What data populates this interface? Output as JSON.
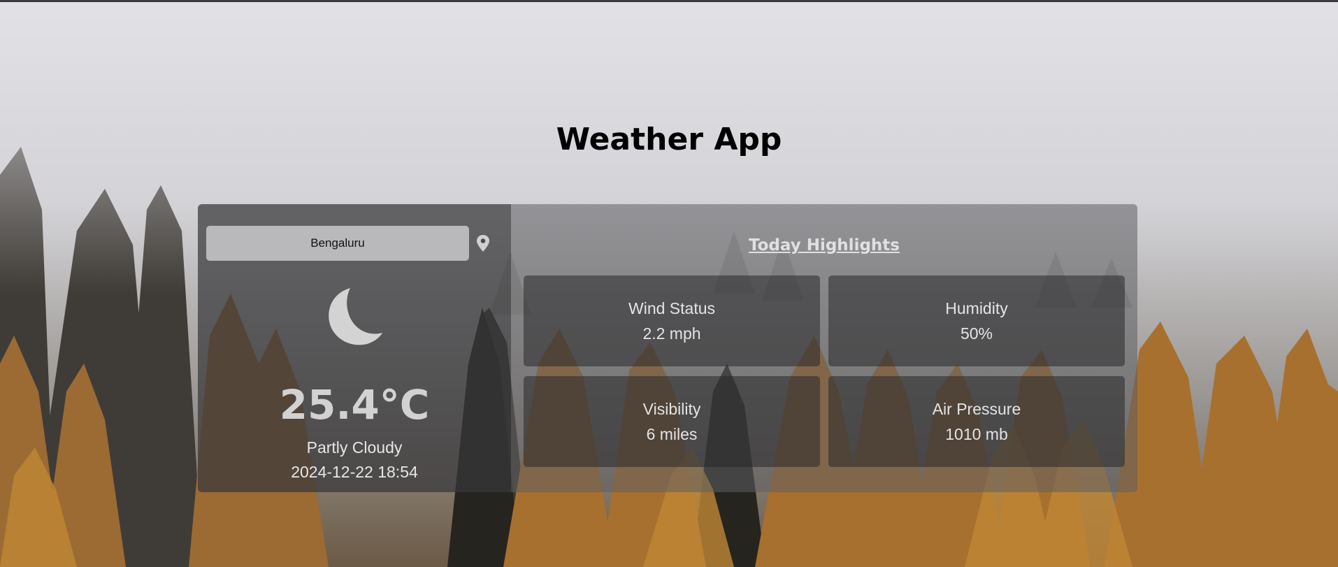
{
  "app": {
    "title": "Weather App"
  },
  "search": {
    "value": "Bengaluru"
  },
  "current": {
    "icon": "moon-icon",
    "temperature": "25.4°C",
    "condition": "Partly Cloudy",
    "datetime": "2024-12-22 18:54"
  },
  "highlights": {
    "heading": "Today Highlights",
    "tiles": [
      {
        "label": "Wind Status",
        "value": "2.2 mph"
      },
      {
        "label": "Humidity",
        "value": "50%"
      },
      {
        "label": "Visibility",
        "value": "6 miles"
      },
      {
        "label": "Air Pressure",
        "value": "1010 mb"
      }
    ]
  },
  "colors": {
    "title_text": "#000000",
    "search_background": "#b9b9bb",
    "tree_orange": "#b8782c",
    "fog": "#e2e1e5"
  }
}
